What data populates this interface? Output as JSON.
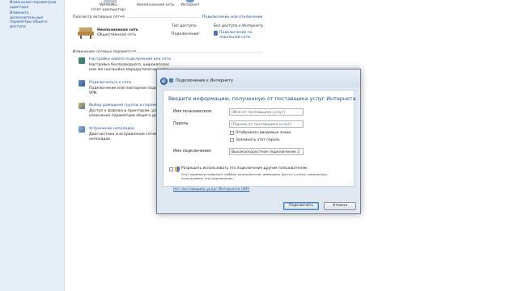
{
  "leftnav": {
    "items": [
      "Изменение параметров адаптера",
      "Изменить дополнительные параметры общего доступа"
    ]
  },
  "netmap": {
    "computer_line1": "WARKING",
    "computer_line2": "(этот компьютер)",
    "network": "Неопознанная сеть",
    "internet": "Интернет"
  },
  "active": {
    "title": "Просмотр активных сетей",
    "connect_link": "Подключение или отключение",
    "network_name": "Неопознанная сеть",
    "network_type": "Общественная сеть",
    "access_label": "Тип доступа:",
    "access_value": "Без доступа к Интернету",
    "connections_label": "Подключения:",
    "connections_value_1": "Подключение по",
    "connections_value_2": "локальной сети"
  },
  "change": {
    "title": "Изменение сетевых параметров",
    "items": [
      {
        "link": "Настройка нового подключения или сети",
        "desc1": "Настройка беспроводного, широкополос",
        "desc2": "или же настройка маршрутизатора или"
      },
      {
        "link": "Подключиться к сети",
        "desc1": "Подключение или повторное подключе",
        "desc2": "VPN."
      },
      {
        "link": "Выбор домашней группы и параметров",
        "desc1": "Доступ к файлам и принтерам, распол",
        "desc2": "изменение параметров общего досту"
      },
      {
        "link": "Устранение неполадок",
        "desc1": "Диагностика и исправление сетевых п",
        "desc2": "неполадок."
      }
    ]
  },
  "dialog": {
    "title": "Подключение к Интернету",
    "heading": "Введите информацию, полученную от поставщика услуг Интернета",
    "username_label": "Имя пользователя:",
    "username_placeholder": "[Имя от поставщика услуг]",
    "password_label": "Пароль:",
    "password_placeholder": "[Пароль от поставщика услуг]",
    "show_chars": "Отображать вводимые знаки",
    "remember_password": "Запомнить этот пароль",
    "connection_name_label": "Имя подключения:",
    "connection_name_value": "Высокоскоростное подключение 2",
    "allow_others": "Разрешить использовать это подключение другим пользователям",
    "allow_note_1": "Этот параметр позволяет любому пользователю, имеющему доступ к этому компьютеру,",
    "allow_note_2": "использовать это подключение.",
    "no_isp_link": "Нет поставщика услуг Интернета (ISP)",
    "connect_button": "Подключить",
    "cancel_button": "Отмена"
  }
}
